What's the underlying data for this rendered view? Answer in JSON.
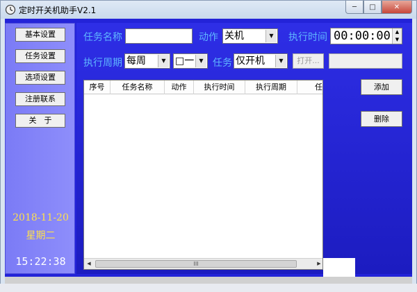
{
  "window": {
    "title": "定时开关机助手V2.1",
    "controls": {
      "minimize": "─",
      "maximize": "□",
      "close": "✕"
    }
  },
  "sidebar": {
    "buttons": [
      "基本设置",
      "任务设置",
      "选项设置",
      "注册联系",
      "关　于"
    ],
    "date": "2018-11-20",
    "weekday": "星期二",
    "time": "15:22:38"
  },
  "form": {
    "task_name_label": "任务名称",
    "task_name_value": "",
    "action_label": "动作",
    "action_value": "关机",
    "exec_time_label": "执行时间",
    "exec_time_value": "00:00:00",
    "period_label": "执行周期",
    "period_value": "每周",
    "weekday_value": "□一",
    "task_label": "任务",
    "task_value": "仅开机",
    "open_button": "打开...",
    "path_value": ""
  },
  "actions": {
    "add": "添加",
    "delete": "删除"
  },
  "table": {
    "columns": [
      "序号",
      "任务名称",
      "动作",
      "执行时间",
      "执行周期",
      "任务"
    ],
    "rows": []
  },
  "scrollbar": {
    "thumb_glyph": "III"
  },
  "colors": {
    "client_bg": "#2323d8",
    "sidebar_bg": "#8080f8",
    "label": "#5fb6ff",
    "date": "#ffe14a"
  }
}
